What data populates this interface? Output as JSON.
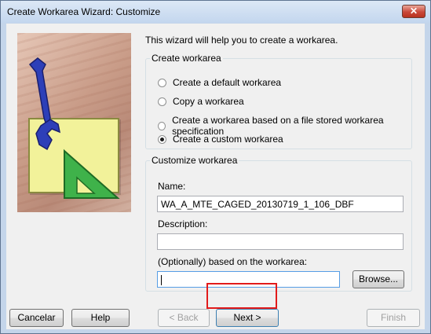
{
  "window": {
    "title": "Create Workarea Wizard: Customize",
    "close_glyph": "✕"
  },
  "intro_text": "This wizard will help you to create a workarea.",
  "create_group": {
    "legend": "Create workarea",
    "options": [
      {
        "label": "Create a default workarea",
        "selected": false
      },
      {
        "label": "Copy a workarea",
        "selected": false
      },
      {
        "label": "Create a workarea based on a file stored workarea specification",
        "selected": false
      },
      {
        "label": "Create a custom workarea",
        "selected": true
      }
    ]
  },
  "customize_group": {
    "legend": "Customize workarea",
    "name_label": "Name:",
    "name_value": "WA_A_MTE_CAGED_20130719_1_106_DBF",
    "description_label": "Description:",
    "description_value": "",
    "based_on_label": "(Optionally) based on the workarea:",
    "based_on_value": "",
    "browse_label": "Browse..."
  },
  "buttons": {
    "cancel": "Cancelar",
    "help": "Help",
    "back": "< Back",
    "next": "Next >",
    "finish": "Finish"
  },
  "colors": {
    "highlight": "#e21b1b",
    "close_button": "#c9483a"
  }
}
